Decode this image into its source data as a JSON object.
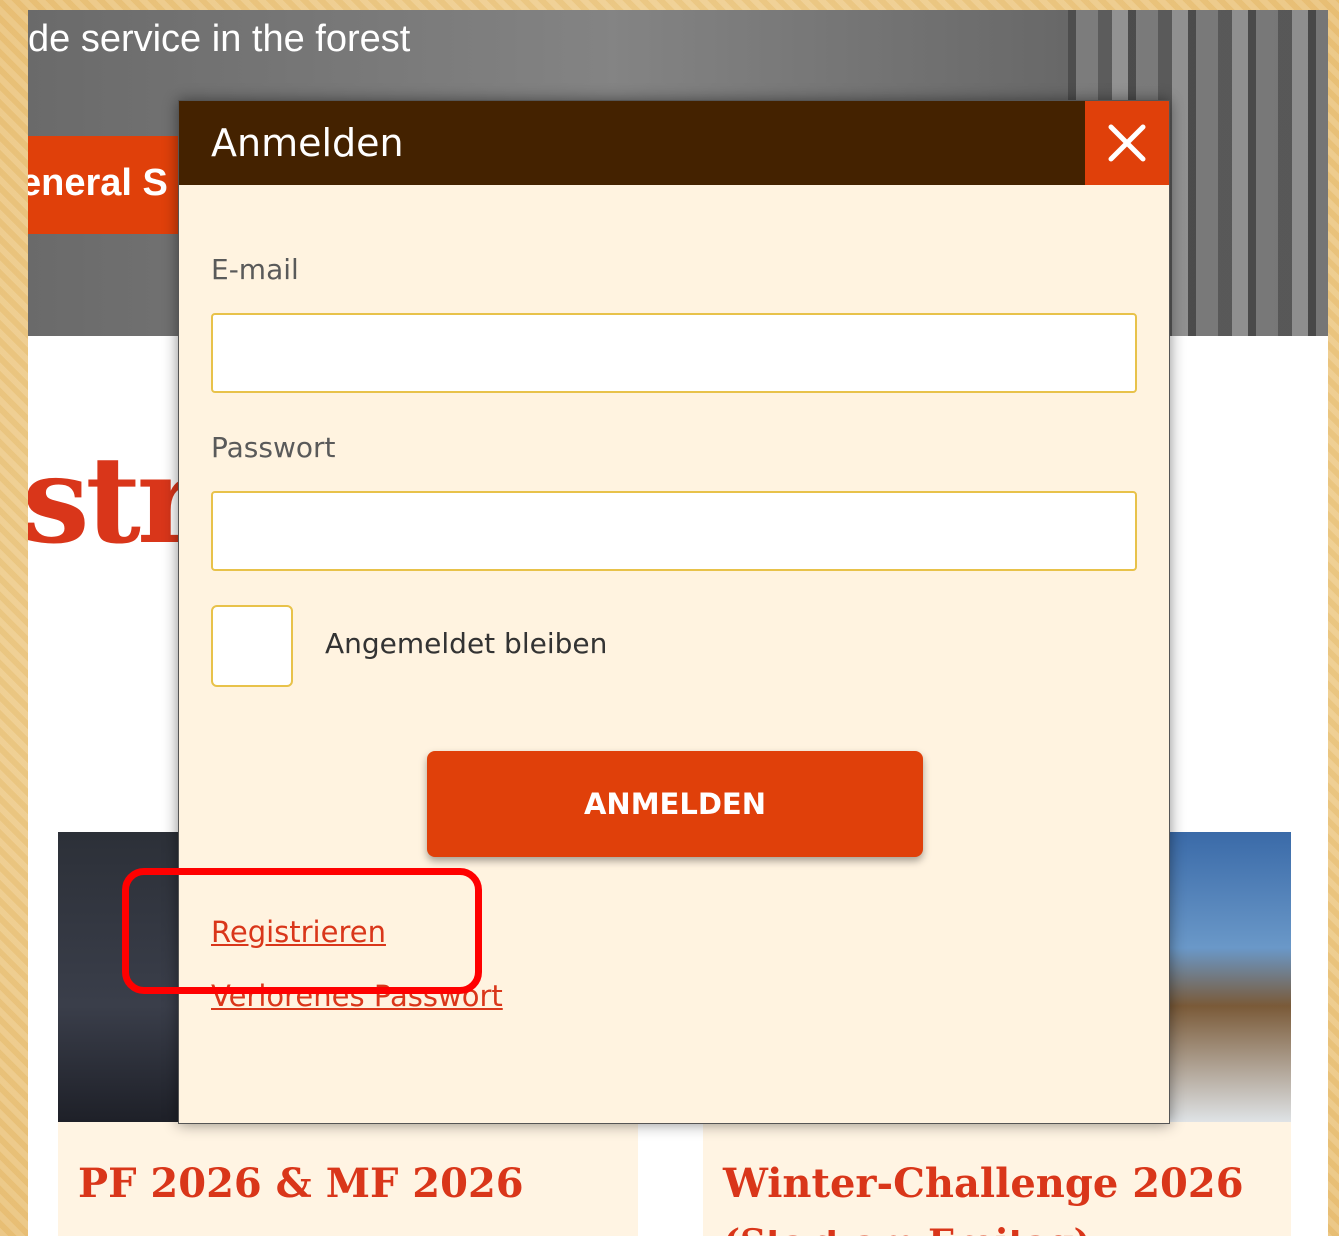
{
  "background_page": {
    "hero_title": "de service in the forest",
    "nav_label": "eneral S",
    "big_title": "str",
    "cards": [
      {
        "title": "PF 2026 & MF 2026",
        "subtitle": ""
      },
      {
        "title": "Winter-Challenge 2026",
        "subtitle": "(Start am Freitag)"
      }
    ]
  },
  "modal": {
    "title": "Anmelden",
    "close_icon": "close-icon",
    "email_label": "E-mail",
    "email_value": "",
    "password_label": "Passwort",
    "password_value": "",
    "remember_label": "Angemeldet bleiben",
    "submit_label": "ANMELDEN",
    "register_link": "Registrieren",
    "lost_password_link": "Verlorenes Passwort"
  },
  "colors": {
    "accent": "#e0400a",
    "header_bg": "#442200",
    "modal_bg": "#fff3e0",
    "highlight": "#ff0000"
  }
}
